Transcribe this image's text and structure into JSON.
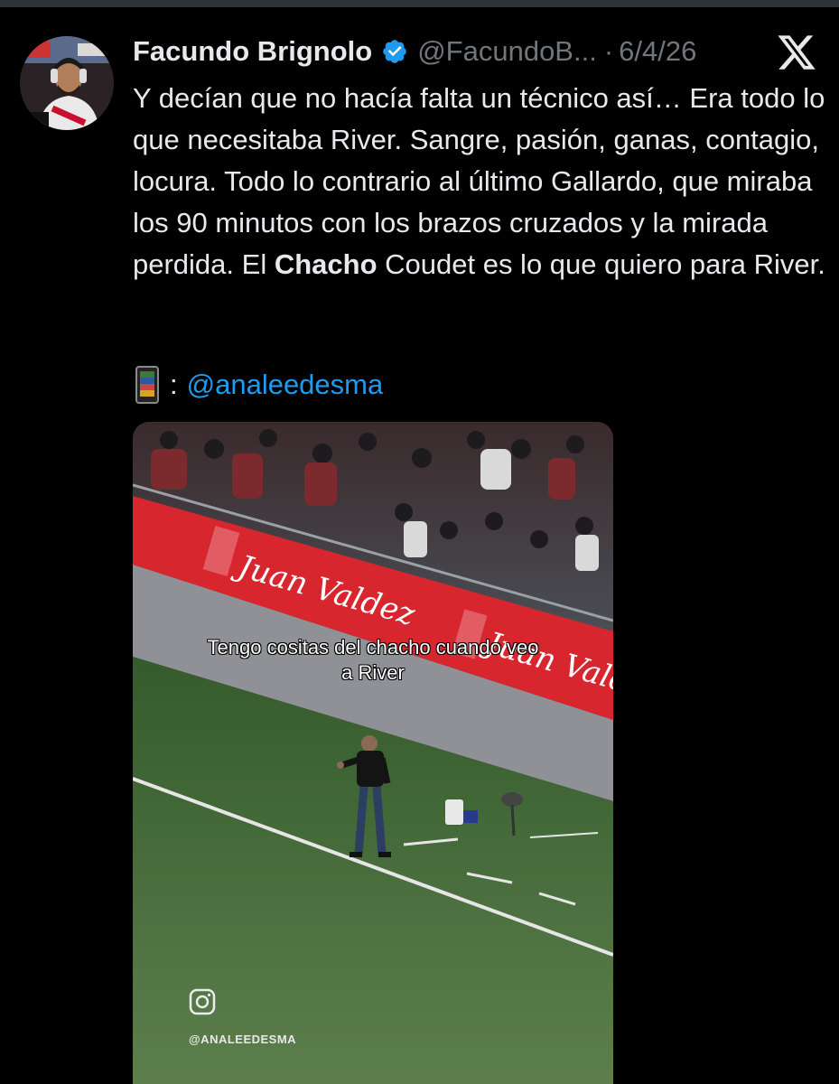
{
  "author": {
    "name": "Facundo Brignolo",
    "handle": "@FacundoB...",
    "separator": "·",
    "date": "6/4/26"
  },
  "post": {
    "text_part1": "Y decían que no hacía falta un técnico así… Era todo lo que necesitaba River. Sangre, pasión, ganas, contagio, locura. Todo lo contrario al último Gallardo, que miraba los 90 minutos con los brazos cruzados y la mirada perdida. El ",
    "text_bold": "Chacho",
    "text_part2": " Coudet es lo que quiero para River.",
    "credit_colon": ":",
    "credit_mention": "@analeedesma"
  },
  "media": {
    "banner_text": "Juan Valdez",
    "caption_line1": "Tengo cositas del chacho cuando veo",
    "caption_line2": "a River",
    "ig_handle": "@ANALEEDESMA"
  },
  "icons": {
    "verified": "verified-badge-icon",
    "platform": "x-logo-icon",
    "credit": "mobile-phone-icon",
    "watermark": "instagram-icon"
  },
  "colors": {
    "background": "#000000",
    "text": "#e7e9ea",
    "secondary": "#71767b",
    "link": "#1d9bf0",
    "banner_red": "#d8262f",
    "pitch_green": "#3f6a35"
  }
}
